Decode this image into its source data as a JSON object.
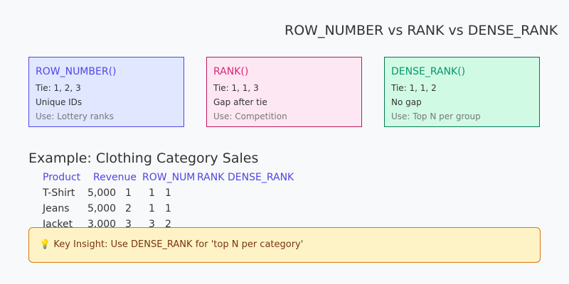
{
  "title": "ROW_NUMBER vs RANK vs DENSE_RANK",
  "cards": [
    {
      "title": "ROW_NUMBER()",
      "tie": "Tie: 1, 2, 3",
      "desc": "Unique IDs",
      "use": "Use: Lottery ranks",
      "color": "#4f46e5"
    },
    {
      "title": "RANK()",
      "tie": "Tie: 1, 1, 3",
      "desc": "Gap after tie",
      "use": "Use: Competition",
      "color": "#db2777"
    },
    {
      "title": "DENSE_RANK()",
      "tie": "Tie: 1, 1, 2",
      "desc": "No gap",
      "use": "Use: Top N per group",
      "color": "#059669"
    }
  ],
  "example": {
    "title": "Example: Clothing Category Sales",
    "headers": [
      "Product",
      "Revenue",
      "ROW_NUM",
      "RANK",
      "DENSE_RANK"
    ],
    "rows": [
      [
        "T-Shirt",
        "5,000",
        "1",
        "1",
        "1"
      ],
      [
        "Jeans",
        "5,000",
        "2",
        "1",
        "1"
      ],
      [
        "Jacket",
        "3,000",
        "3",
        "3",
        "2"
      ]
    ]
  },
  "insight": {
    "icon": "lightbulb-icon",
    "text": "💡 Key Insight: Use DENSE_RANK for 'top N per category'"
  }
}
